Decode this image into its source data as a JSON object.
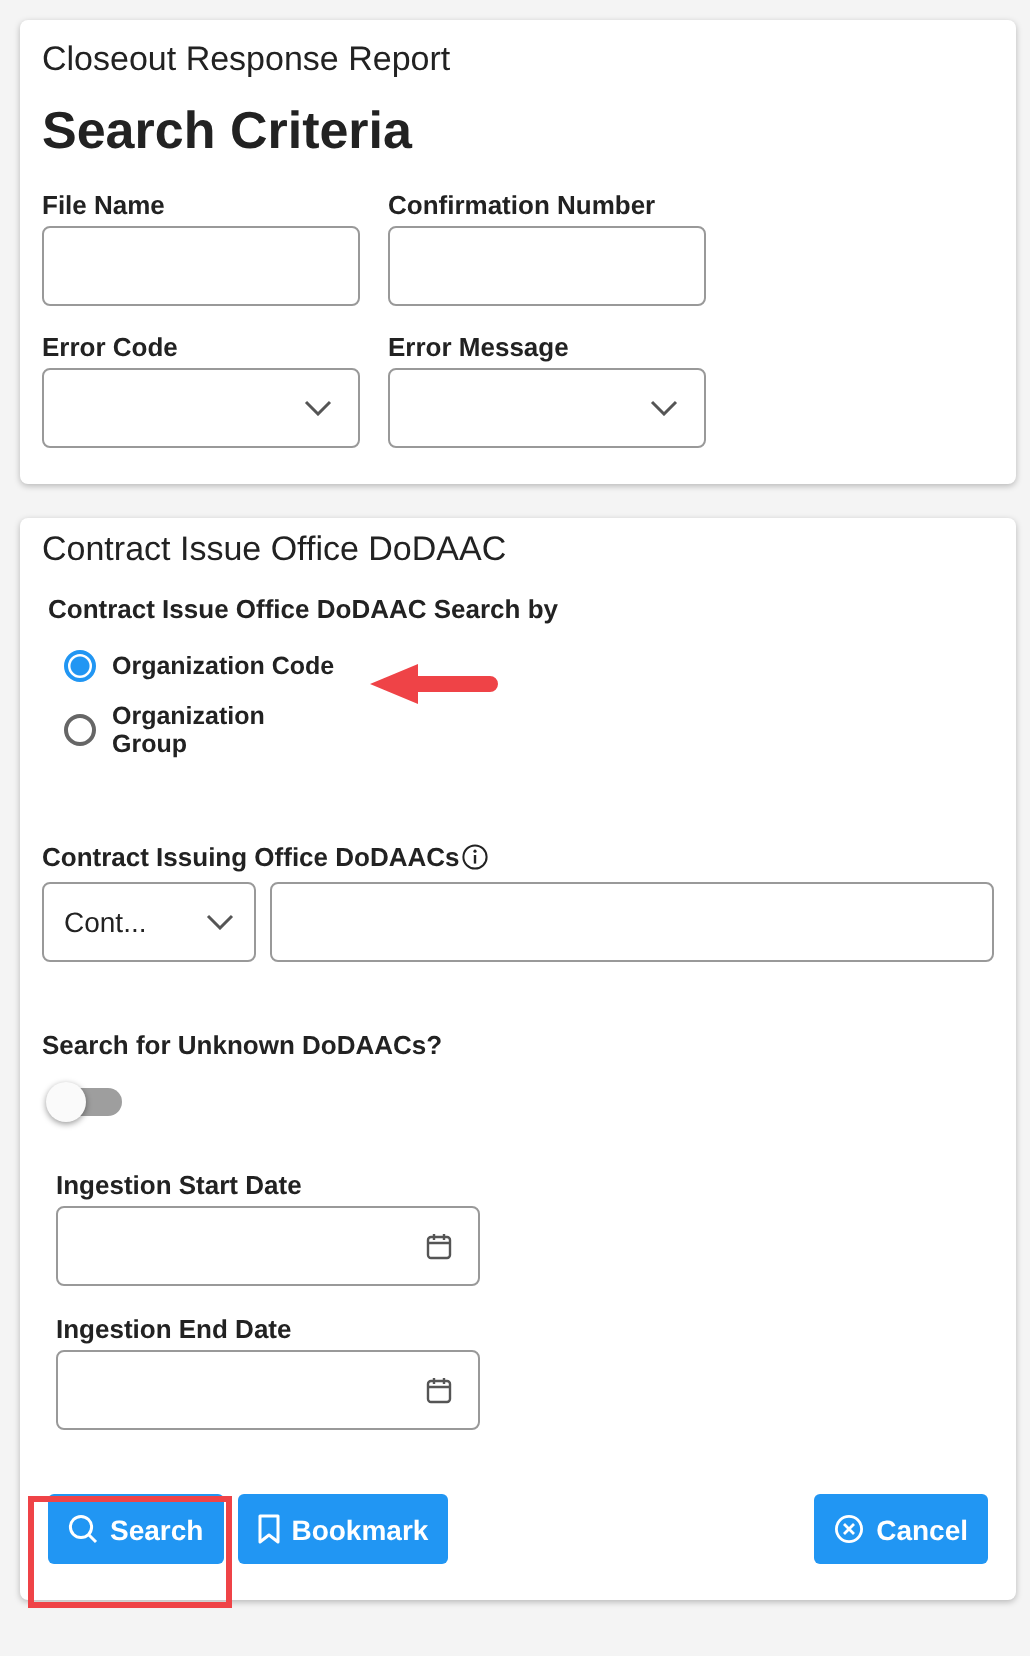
{
  "report_title": "Closeout Response Report",
  "criteria": {
    "heading": "Search Criteria",
    "fields": [
      {
        "kind": "text",
        "label": "File Name"
      },
      {
        "kind": "text",
        "label": "Confirmation Number"
      },
      {
        "kind": "select",
        "label": "Error Code"
      },
      {
        "kind": "select",
        "label": "Error Message"
      }
    ]
  },
  "dodaac": {
    "heading": "Contract Issue Office DoDAAC",
    "search_by_label": "Contract Issue Office DoDAAC Search by",
    "options": [
      {
        "label": "Organization Code",
        "selected": true
      },
      {
        "label": "Organization Group",
        "selected": false
      }
    ],
    "dodaacs_label": "Contract Issuing Office DoDAACs",
    "dodaacs_select": "Cont...",
    "unknown_label": "Search for Unknown DoDAACs?",
    "unknown_on": false,
    "dates": [
      {
        "label": "Ingestion Start Date"
      },
      {
        "label": "Ingestion End Date"
      }
    ]
  },
  "buttons": [
    {
      "kind": "search",
      "label": "Search"
    },
    {
      "kind": "bookmark",
      "label": "Bookmark"
    },
    {
      "kind": "cancel",
      "label": "Cancel"
    }
  ],
  "annotations": [
    {
      "kind": "arrow"
    },
    {
      "kind": "highlight"
    }
  ]
}
